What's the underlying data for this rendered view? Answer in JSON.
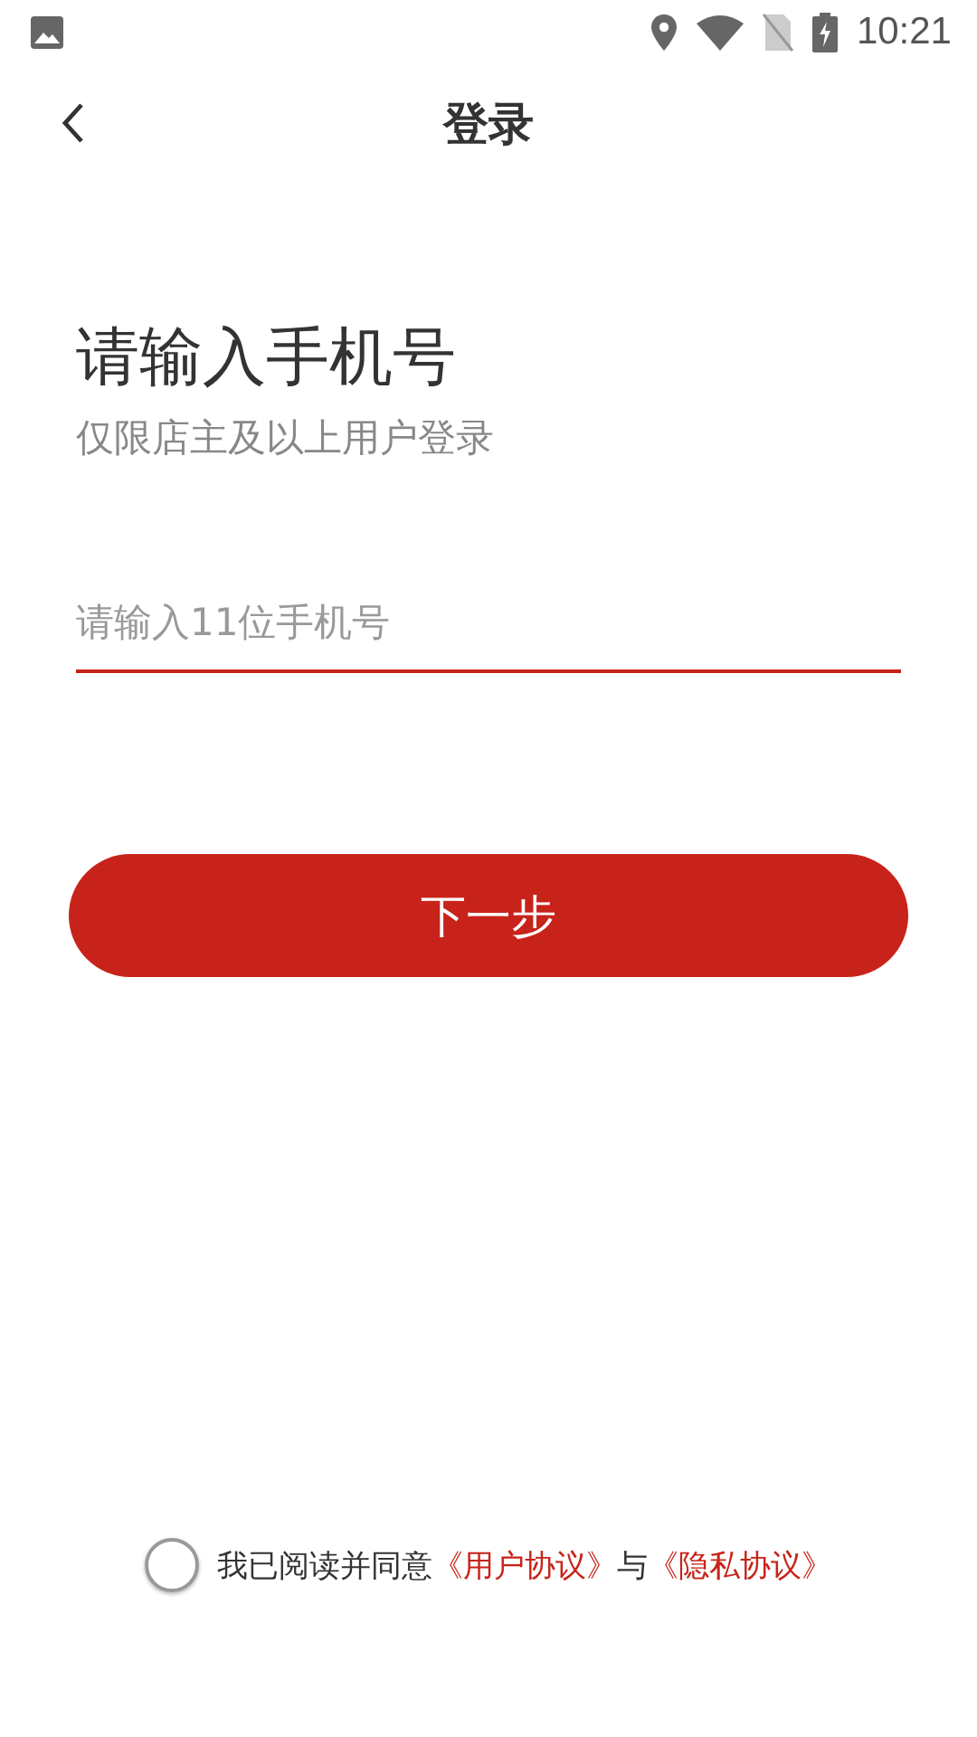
{
  "status_bar": {
    "time": "10:21"
  },
  "header": {
    "title": "登录"
  },
  "heading": "请输入手机号",
  "subtitle": "仅限店主及以上用户登录",
  "phone_field": {
    "placeholder": "请输入11位手机号"
  },
  "next_button": "下一步",
  "agreement": {
    "checked": false,
    "parts": [
      {
        "kind": "text",
        "text": "我已阅读并同意"
      },
      {
        "kind": "link",
        "text": "《用户协议》"
      },
      {
        "kind": "text",
        "text": "与"
      },
      {
        "kind": "link",
        "text": "《隐私协议》"
      }
    ]
  }
}
